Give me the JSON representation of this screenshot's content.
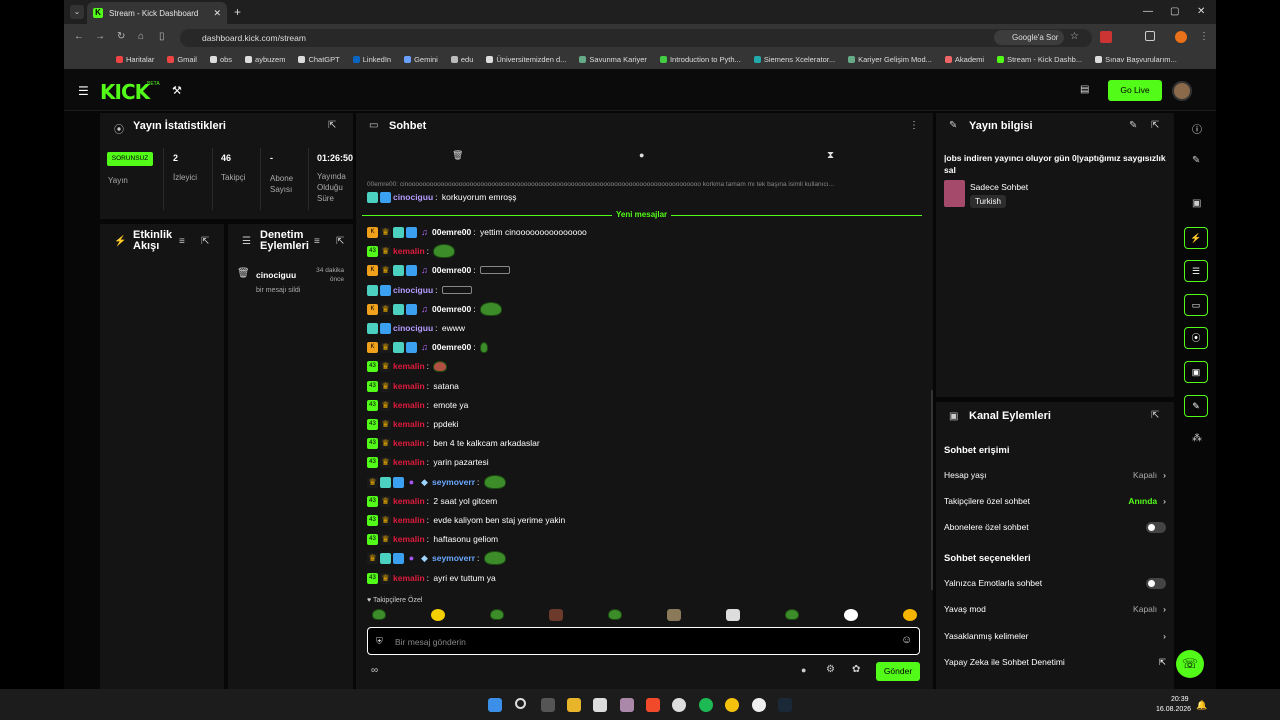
{
  "browser": {
    "tab_title": "Stream - Kick Dashboard",
    "url": "dashboard.kick.com/stream",
    "google_btn": "Google'a Sor",
    "bookmarks": [
      "Haritalar",
      "Gmail",
      "obs",
      "aybuzem",
      "ChatGPT",
      "LinkedIn",
      "Gemini",
      "edu",
      "Üniversitemizden d...",
      "Savunma Kariyer",
      "Introduction to Pyth...",
      "Siemens Xcelerator...",
      "Kariyer Gelişim Mod...",
      "Akademi",
      "Stream - Kick Dashb...",
      "Sınav Başvurularım..."
    ]
  },
  "header": {
    "logo": "KICK",
    "beta": "BETA",
    "go_live": "Go Live"
  },
  "stats": {
    "title": "Yayın İstatistikleri",
    "status_badge": "SORUNSUZ",
    "status_label": "Yayın",
    "viewers_value": "2",
    "viewers_label": "İzleyici",
    "followers_value": "46",
    "followers_label": "Takipçi",
    "subs_value": "-",
    "subs_label": "Abone Sayısı",
    "uptime_value": "01:26:50",
    "uptime_label": "Yayında Olduğu Süre"
  },
  "activity": {
    "title": "Etkinlik Akışı"
  },
  "moderation": {
    "title": "Denetim Eylemleri",
    "entry_user": "cinociguu",
    "entry_time": "34 dakika önce",
    "entry_action": "bir mesajı sildi"
  },
  "chat": {
    "title": "Sohbet",
    "reply_preview": "00emre00: cinooooooooooooooooooooooooooooooooooooooooooooooooooooooooooooooooooooooooooooooooo korkma tamam mı tek başına isimli kullanıcı...",
    "top_msg_user": "cinociguu",
    "top_msg_text": "korkuyorum emroşş",
    "new_messages": "Yeni mesajlar",
    "messages": [
      {
        "user": "00emre00",
        "text": "yettim cinooooooooooooooo",
        "type": "00"
      },
      {
        "user": "kemalin",
        "text": "",
        "type": "kem",
        "emote": "frog"
      },
      {
        "user": "00emre00",
        "text": "",
        "type": "00",
        "emote": "text-emote"
      },
      {
        "user": "cinociguu",
        "text": "",
        "type": "cino",
        "emote": "text-emote"
      },
      {
        "user": "00emre00",
        "text": "",
        "type": "00",
        "emote": "frog"
      },
      {
        "user": "cinociguu",
        "text": "ewww",
        "type": "cino"
      },
      {
        "user": "00emre00",
        "text": "",
        "type": "00",
        "emote": "small-frogs"
      },
      {
        "user": "kemalin",
        "text": "",
        "type": "kem",
        "emote": "frog-red"
      },
      {
        "user": "kemalin",
        "text": "satana",
        "type": "kem"
      },
      {
        "user": "kemalin",
        "text": "emote ya",
        "type": "kem"
      },
      {
        "user": "kemalin",
        "text": "ppdeki",
        "type": "kem"
      },
      {
        "user": "kemalin",
        "text": "ben 4 te kalkcam arkadaslar",
        "type": "kem"
      },
      {
        "user": "kemalin",
        "text": "yarin pazartesi",
        "type": "kem"
      },
      {
        "user": "seymoverr",
        "text": "",
        "type": "sey",
        "emote": "frog"
      },
      {
        "user": "kemalin",
        "text": "2 saat yol gitcem",
        "type": "kem"
      },
      {
        "user": "kemalin",
        "text": "evde kaliyom ben staj yerime yakin",
        "type": "kem"
      },
      {
        "user": "kemalin",
        "text": "haftasonu geliom",
        "type": "kem"
      },
      {
        "user": "seymoverr",
        "text": "",
        "type": "sey",
        "emote": "frog"
      },
      {
        "user": "kemalin",
        "text": "ayri ev tuttum ya",
        "type": "kem"
      }
    ],
    "followers_only": "Takipçilere Özel",
    "input_placeholder": "Bir mesaj gönderin",
    "send": "Gönder"
  },
  "stream_info": {
    "title": "Yayın bilgisi",
    "stream_title": "|obs indiren yayıncı oluyor gün 0|yaptığımız saygısızlık sal",
    "category": "Sadece Sohbet",
    "tag": "Turkish"
  },
  "channel_actions": {
    "title": "Kanal Eylemleri",
    "chat_access": "Sohbet erişimi",
    "account_age": "Hesap yaşı",
    "account_age_val": "Kapalı",
    "followers_chat": "Takipçilere özel sohbet",
    "followers_chat_val": "Anında",
    "subs_chat": "Abonelere özel sohbet",
    "chat_options": "Sohbet seçenekleri",
    "emote_only": "Yalnızca Emotlarla sohbet",
    "slow_mode": "Yavaş mod",
    "slow_mode_val": "Kapalı",
    "banned_words": "Yasaklanmış kelimeler",
    "ai_mod": "Yapay Zeka ile Sohbet Denetimi"
  },
  "taskbar": {
    "time": "20:39",
    "date": "16.08.2026"
  }
}
